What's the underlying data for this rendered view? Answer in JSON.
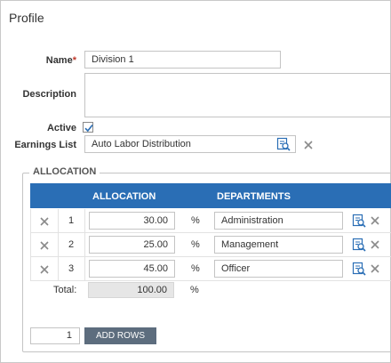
{
  "page": {
    "title": "Profile"
  },
  "form": {
    "name_label": "Name",
    "required_marker": "*",
    "name_value": "Division 1",
    "description_label": "Description",
    "description_value": "",
    "active_label": "Active",
    "active_checked": true,
    "earnings_label": "Earnings List",
    "earnings_value": "Auto Labor Distribution"
  },
  "allocation": {
    "legend": "ALLOCATION",
    "columns": {
      "allocation": "ALLOCATION",
      "departments": "DEPARTMENTS"
    },
    "rows": [
      {
        "num": "1",
        "value": "30.00",
        "unit": "%",
        "department": "Administration"
      },
      {
        "num": "2",
        "value": "25.00",
        "unit": "%",
        "department": "Management"
      },
      {
        "num": "3",
        "value": "45.00",
        "unit": "%",
        "department": "Officer"
      }
    ],
    "total_label": "Total:",
    "total_value": "100.00",
    "total_unit": "%",
    "add_rows_count": "1",
    "add_rows_label": "ADD ROWS"
  },
  "colors": {
    "header_bg": "#2a6eb5",
    "button_bg": "#5d6d7e",
    "icon_blue": "#2a6eb5",
    "required": "#c0392b"
  },
  "icons": {
    "lookup": "lookup-icon",
    "clear": "close-icon",
    "checkbox": "check-icon"
  }
}
